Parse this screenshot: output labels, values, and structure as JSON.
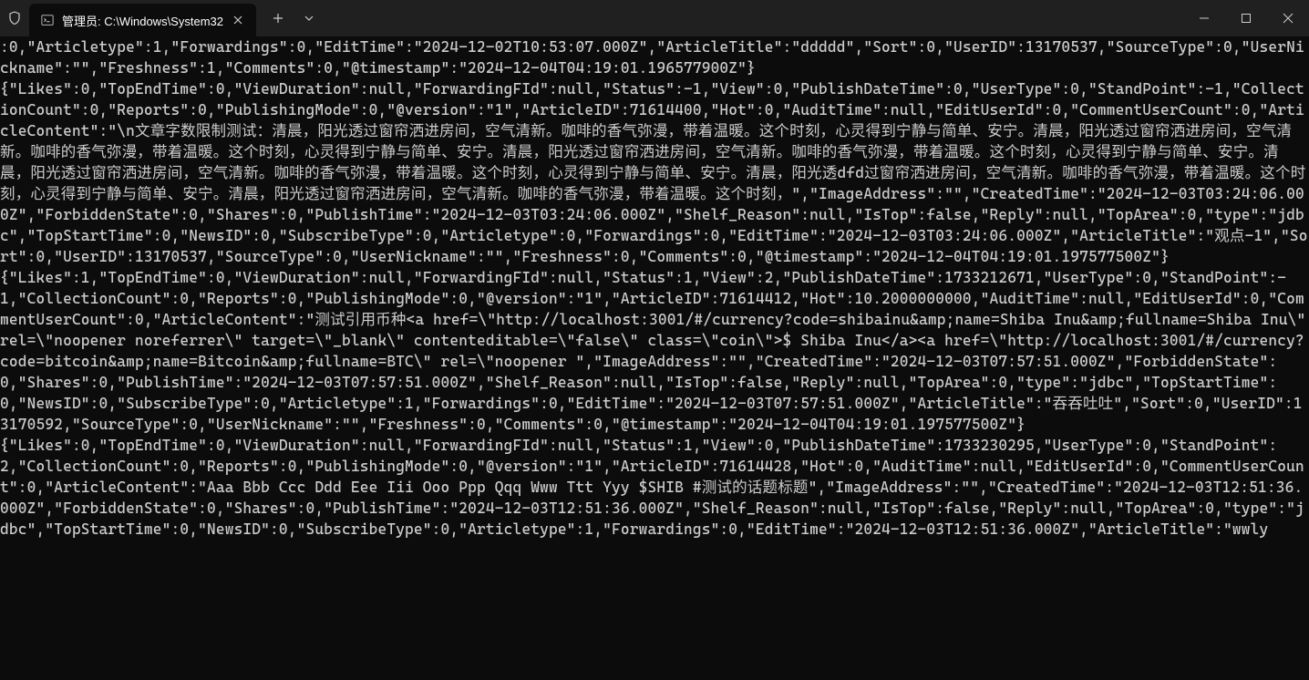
{
  "titlebar": {
    "tab_title": "管理员: C:\\Windows\\System32",
    "shield_title": "Admin shield"
  },
  "terminal": {
    "content": ":0,\"Articletype\":1,\"Forwardings\":0,\"EditTime\":\"2024-12-02T10:53:07.000Z\",\"ArticleTitle\":\"ddddd\",\"Sort\":0,\"UserID\":13170537,\"SourceType\":0,\"UserNickname\":\"\",\"Freshness\":1,\"Comments\":0,\"@timestamp\":\"2024-12-04T04:19:01.196577900Z\"}\n{\"Likes\":0,\"TopEndTime\":0,\"ViewDuration\":null,\"ForwardingFId\":null,\"Status\":-1,\"View\":0,\"PublishDateTime\":0,\"UserType\":0,\"StandPoint\":-1,\"CollectionCount\":0,\"Reports\":0,\"PublishingMode\":0,\"@version\":\"1\",\"ArticleID\":71614400,\"Hot\":0,\"AuditTime\":null,\"EditUserId\":0,\"CommentUserCount\":0,\"ArticleContent\":\"\\n文章字数限制测试：清晨，阳光透过窗帘洒进房间，空气清新。咖啡的香气弥漫，带着温暖。这个时刻，心灵得到宁静与简单、安宁。清晨，阳光透过窗帘洒进房间，空气清新。咖啡的香气弥漫，带着温暖。这个时刻，心灵得到宁静与简单、安宁。清晨，阳光透过窗帘洒进房间，空气清新。咖啡的香气弥漫，带着温暖。这个时刻，心灵得到宁静与简单、安宁。清晨，阳光透过窗帘洒进房间，空气清新。咖啡的香气弥漫，带着温暖。这个时刻，心灵得到宁静与简单、安宁。清晨，阳光透dfd过窗帘洒进房间，空气清新。咖啡的香气弥漫，带着温暖。这个时刻，心灵得到宁静与简单、安宁。清晨，阳光透过窗帘洒进房间，空气清新。咖啡的香气弥漫，带着温暖。这个时刻，\",\"ImageAddress\":\"\",\"CreatedTime\":\"2024-12-03T03:24:06.000Z\",\"ForbiddenState\":0,\"Shares\":0,\"PublishTime\":\"2024-12-03T03:24:06.000Z\",\"Shelf_Reason\":null,\"IsTop\":false,\"Reply\":null,\"TopArea\":0,\"type\":\"jdbc\",\"TopStartTime\":0,\"NewsID\":0,\"SubscribeType\":0,\"Articletype\":0,\"Forwardings\":0,\"EditTime\":\"2024-12-03T03:24:06.000Z\",\"ArticleTitle\":\"观点-1\",\"Sort\":0,\"UserID\":13170537,\"SourceType\":0,\"UserNickname\":\"\",\"Freshness\":0,\"Comments\":0,\"@timestamp\":\"2024-12-04T04:19:01.197577500Z\"}\n{\"Likes\":1,\"TopEndTime\":0,\"ViewDuration\":null,\"ForwardingFId\":null,\"Status\":1,\"View\":2,\"PublishDateTime\":1733212671,\"UserType\":0,\"StandPoint\":-1,\"CollectionCount\":0,\"Reports\":0,\"PublishingMode\":0,\"@version\":\"1\",\"ArticleID\":71614412,\"Hot\":10.2000000000,\"AuditTime\":null,\"EditUserId\":0,\"CommentUserCount\":0,\"ArticleContent\":\"测试引用币种<a href=\\\"http://localhost:3001/#/currency?code=shibainu&amp;name=Shiba Inu&amp;fullname=Shiba Inu\\\" rel=\\\"noopener noreferrer\\\" target=\\\"_blank\\\" contenteditable=\\\"false\\\" class=\\\"coin\\\">$ Shiba Inu</a><a href=\\\"http://localhost:3001/#/currency?code=bitcoin&amp;name=Bitcoin&amp;fullname=BTC\\\" rel=\\\"noopener \",\"ImageAddress\":\"\",\"CreatedTime\":\"2024-12-03T07:57:51.000Z\",\"ForbiddenState\":0,\"Shares\":0,\"PublishTime\":\"2024-12-03T07:57:51.000Z\",\"Shelf_Reason\":null,\"IsTop\":false,\"Reply\":null,\"TopArea\":0,\"type\":\"jdbc\",\"TopStartTime\":0,\"NewsID\":0,\"SubscribeType\":0,\"Articletype\":1,\"Forwardings\":0,\"EditTime\":\"2024-12-03T07:57:51.000Z\",\"ArticleTitle\":\"吞吞吐吐\",\"Sort\":0,\"UserID\":13170592,\"SourceType\":0,\"UserNickname\":\"\",\"Freshness\":0,\"Comments\":0,\"@timestamp\":\"2024-12-04T04:19:01.197577500Z\"}\n{\"Likes\":0,\"TopEndTime\":0,\"ViewDuration\":null,\"ForwardingFId\":null,\"Status\":1,\"View\":0,\"PublishDateTime\":1733230295,\"UserType\":0,\"StandPoint\":2,\"CollectionCount\":0,\"Reports\":0,\"PublishingMode\":0,\"@version\":\"1\",\"ArticleID\":71614428,\"Hot\":0,\"AuditTime\":null,\"EditUserId\":0,\"CommentUserCount\":0,\"ArticleContent\":\"Aaa Bbb Ccc Ddd Eee Iii Ooo Ppp Qqq Www Ttt Yyy $SHIB #测试的话题标题\",\"ImageAddress\":\"\",\"CreatedTime\":\"2024-12-03T12:51:36.000Z\",\"ForbiddenState\":0,\"Shares\":0,\"PublishTime\":\"2024-12-03T12:51:36.000Z\",\"Shelf_Reason\":null,\"IsTop\":false,\"Reply\":null,\"TopArea\":0,\"type\":\"jdbc\",\"TopStartTime\":0,\"NewsID\":0,\"SubscribeType\":0,\"Articletype\":1,\"Forwardings\":0,\"EditTime\":\"2024-12-03T12:51:36.000Z\",\"ArticleTitle\":\"wwly"
  }
}
